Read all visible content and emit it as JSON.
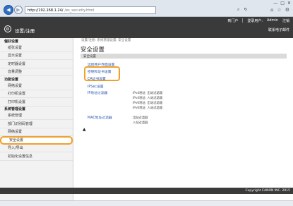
{
  "browser": {
    "url_host": "http://192.168.1.24/",
    "url_path": "/es_security.html",
    "win_min": "—",
    "win_max": "□",
    "win_close": "✕"
  },
  "header": {
    "title": "设置/注册",
    "top_links": [
      "到门户",
      "登录用户: ",
      "Admin",
      "注销"
    ],
    "mail_link": "联系电子邮件"
  },
  "sidebar": {
    "section_prefs": "偏好设置",
    "prefs_items": [
      "纸张设置",
      "显示设置",
      "定时器设置",
      "音量调整"
    ],
    "section_settings": "功能设置",
    "settings_items": [
      "网络设置",
      "打印机设置",
      "打印机设置"
    ],
    "section_mgmt": "系统管理设置",
    "mgmt_items": [
      "系统管理",
      "部门识别码管理",
      "网络设置",
      "安全设置",
      "导入/导出",
      "初始化设置信息"
    ]
  },
  "main": {
    "breadcrumb": "设置/注册: 系统管理设置: 安全设置",
    "title": "安全设置",
    "section": "安全设置",
    "links": [
      "远程用户界面设置",
      "密钥和证书设置",
      "CA证书设置",
      "IPSec设置",
      "IP地址过滤器",
      "MAC地址过滤器"
    ],
    "ip_filter_notes": [
      "IPv4地址: 出站过滤器",
      "IPv4地址: 入站过滤器",
      "IPv6地址: 出站过滤器",
      "IPv6地址: 入站过滤器"
    ],
    "mac_filter_notes": [
      "出站过滤器",
      "入站过滤器"
    ],
    "top_arrow": "▲"
  },
  "footer": {
    "copyright": "Copyright CANON INC. 2015"
  }
}
